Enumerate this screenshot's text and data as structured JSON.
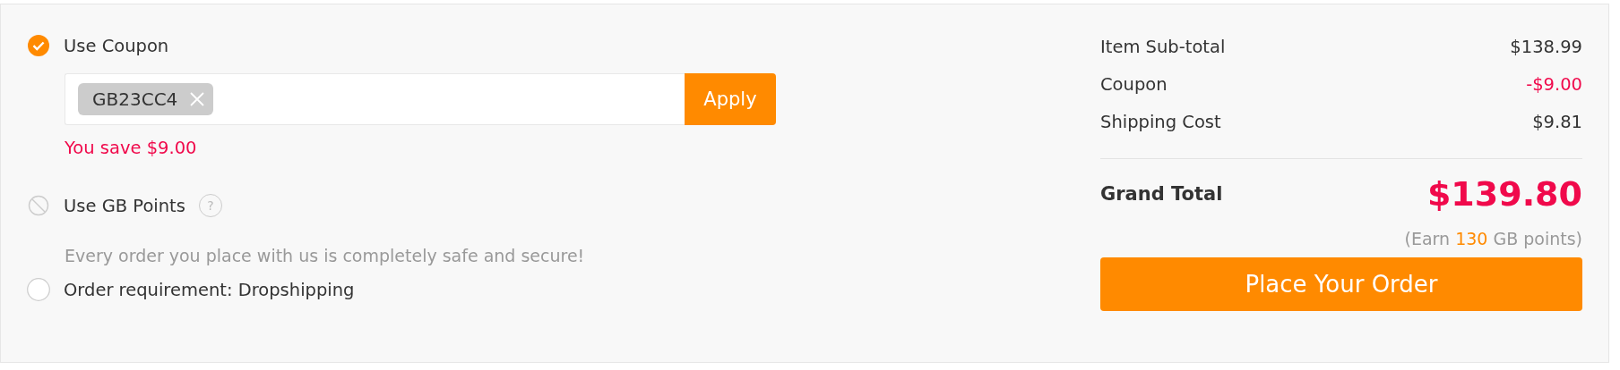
{
  "coupon": {
    "label": "Use Coupon",
    "checked": true,
    "disabled": false,
    "code": "GB23CC4",
    "apply": "Apply",
    "saving": "You save $9.00"
  },
  "points": {
    "label": "Use GB Points",
    "disabled": true,
    "help": "?"
  },
  "note": "Every order you place with us is completely safe and secure!",
  "requirement": {
    "label": "Order requirement: Dropshipping",
    "checked": false,
    "disabled": false
  },
  "summary": {
    "rows": [
      {
        "label": "Item Sub-total",
        "value": "$138.99",
        "kind": "charge"
      },
      {
        "label": "Coupon",
        "value": "-$9.00",
        "kind": "discount"
      },
      {
        "label": "Shipping Cost",
        "value": "$9.81",
        "kind": "charge"
      }
    ],
    "grand_total": {
      "label": "Grand Total",
      "value": "$139.80"
    },
    "earn": {
      "before": "(Earn ",
      "points": "130",
      "after": " GB points)"
    },
    "button": "Place Your Order"
  }
}
